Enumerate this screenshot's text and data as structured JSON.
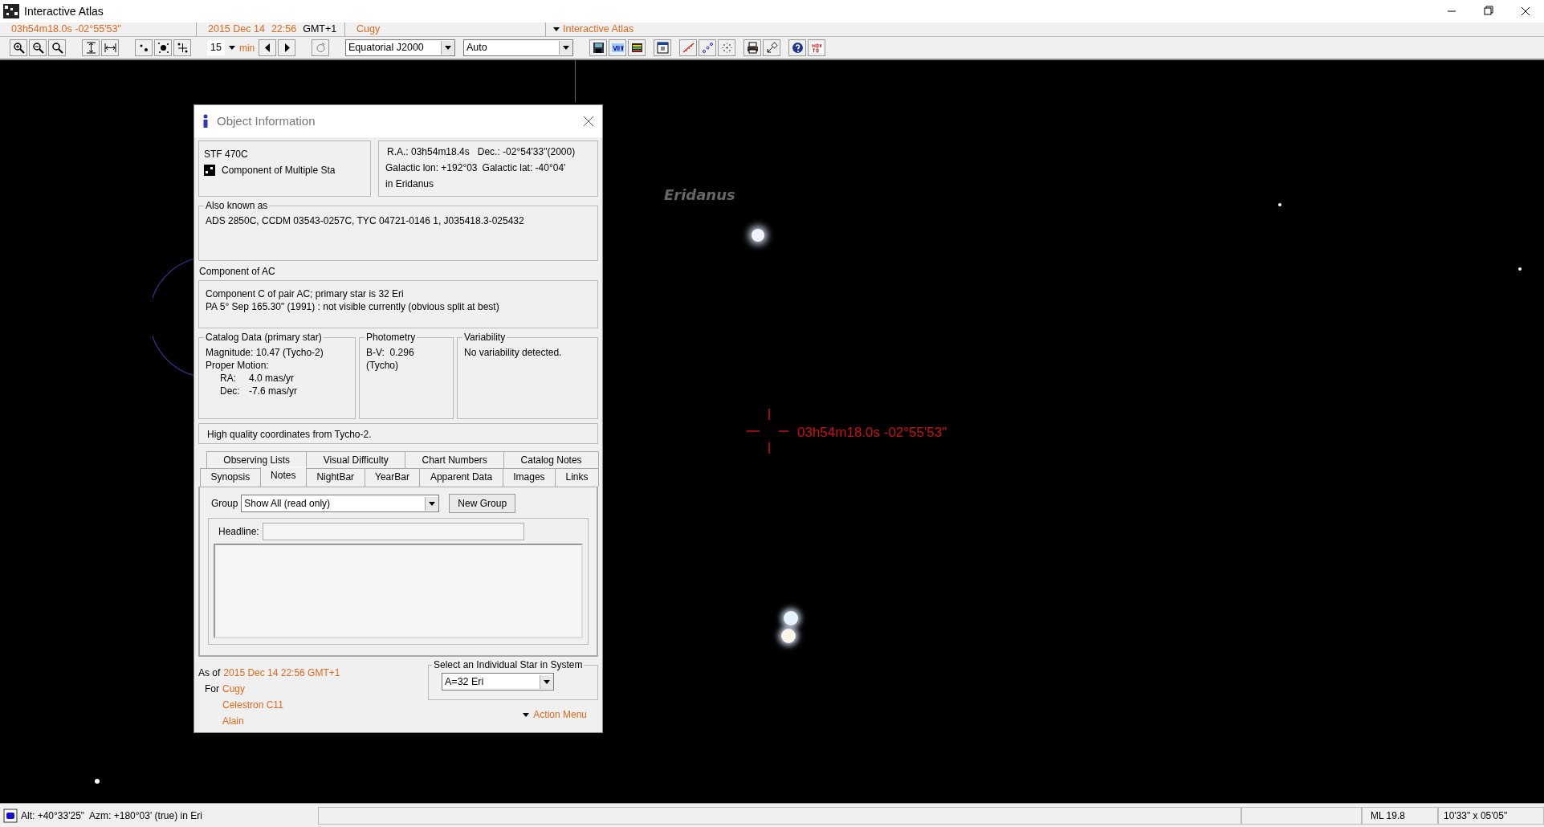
{
  "window": {
    "title": "Interactive Atlas"
  },
  "info_strip": {
    "coordinates": "03h54m18.0s -02°55'53\"",
    "date": "2015 Dec 14",
    "time": "22:56",
    "timezone": "GMT+1",
    "observer": "Cugy",
    "mode": "Interactive Atlas"
  },
  "toolbar": {
    "step_value": "15",
    "step_unit": "min",
    "coordinate_system": "Equatorial J2000",
    "display_mode": "Auto"
  },
  "chart": {
    "constellation_label": "Eridanus",
    "cursor_label": "03h54m18.0s -02°55'53\""
  },
  "dialog": {
    "title": "Object Information",
    "object_name": "STF 470C",
    "object_type": "Component of Multiple Sta",
    "ra": "R.A.: 03h54m18.4s",
    "dec": "Dec.: -02°54'33\"(2000)",
    "galactic_lon": "Galactic lon: +192°03",
    "galactic_lat": "Galactic lat: -40°04'",
    "constellation": "in Eridanus",
    "also_known_as": {
      "legend": "Also known as",
      "text": "ADS 2850C, CCDM 03543-0257C, TYC 04721-0146 1, J035418.3-025432"
    },
    "component": {
      "label": "Component of AC",
      "lines": [
        "Component C of pair AC; primary star is 32 Eri",
        "PA 5° Sep 165.30\" (1991) : not visible currently (obvious split at best)"
      ]
    },
    "catalog": {
      "legend": "Catalog Data (primary star)",
      "magnitude": "Magnitude: 10.47 (Tycho-2)",
      "proper_motion": "Proper Motion:",
      "ra_label": "RA:",
      "ra_value": "4.0 mas/yr",
      "dec_label": "Dec:",
      "dec_value": "-7.6 mas/yr"
    },
    "photometry": {
      "legend": "Photometry",
      "lines": [
        "B-V:  0.296",
        "(Tycho)"
      ]
    },
    "variability": {
      "legend": "Variability",
      "text": "No variability detected."
    },
    "quality_note": "High quality coordinates from Tycho-2.",
    "tab_rows": [
      [
        {
          "label": "Observing Lists",
          "selected": false
        },
        {
          "label": "Visual Difficulty",
          "selected": false
        },
        {
          "label": "Chart Numbers",
          "selected": false
        },
        {
          "label": "Catalog Notes",
          "selected": false
        }
      ],
      [
        {
          "label": "Synopsis",
          "selected": false
        },
        {
          "label": "Notes",
          "selected": true
        },
        {
          "label": "NightBar",
          "selected": false
        },
        {
          "label": "YearBar",
          "selected": false
        },
        {
          "label": "Apparent Data",
          "selected": false
        },
        {
          "label": "Images",
          "selected": false
        },
        {
          "label": "Links",
          "selected": false
        }
      ]
    ],
    "notes": {
      "group_label": "Group",
      "group_value": "Show All (read only)",
      "new_group_button": "New Group",
      "headline_label": "Headline:"
    },
    "footer": {
      "as_of_label": "As of",
      "as_of_value": "2015 Dec 14 22:56 GMT+1",
      "for_label": "For",
      "for_values": [
        "Cugy",
        "Celestron C11",
        "Alain"
      ],
      "star_select_legend": "Select an Individual Star in System",
      "star_select_value": "A=32 Eri",
      "action_menu": "Action Menu"
    }
  },
  "status_bar": {
    "position": "Alt: +40°33'25\"  Azm: +180°03' (true) in Eri",
    "limiting_magnitude": "ML 19.8",
    "field_size": "10'33\" x 05'05\""
  }
}
